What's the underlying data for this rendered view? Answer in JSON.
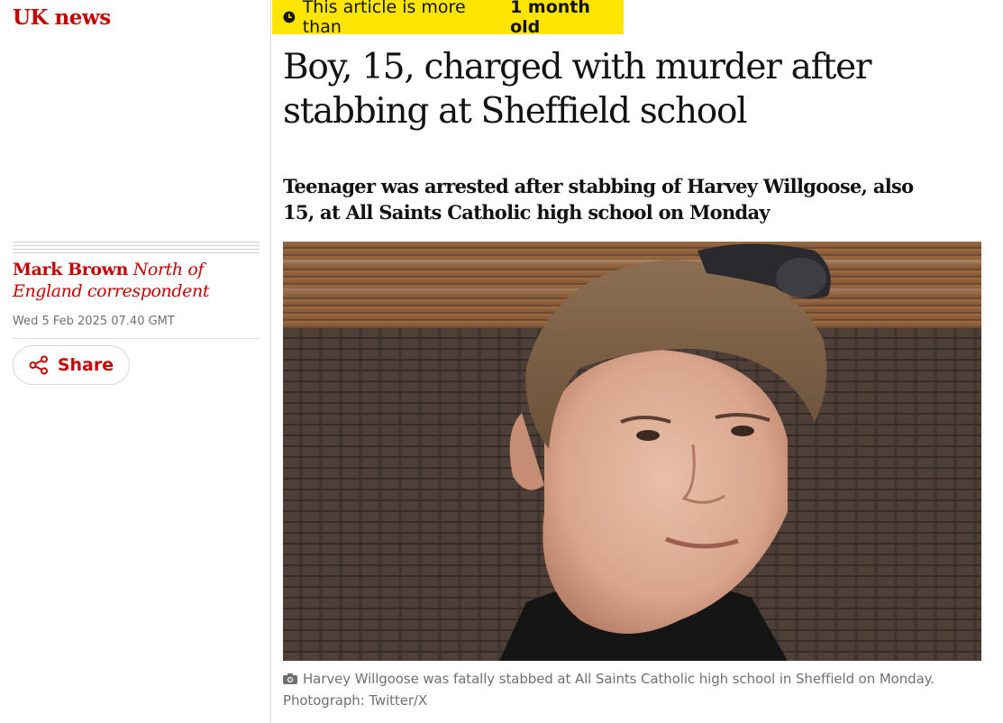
{
  "section": {
    "label": "UK news"
  },
  "byline": {
    "author": "Mark Brown",
    "role": "North of England correspondent",
    "date": "Wed 5 Feb 2025 07.40 GMT"
  },
  "share": {
    "label": "Share",
    "icon": "share-icon"
  },
  "age_notice": {
    "prefix": "This article is more than",
    "emphasis": "1 month old",
    "icon": "clock-icon"
  },
  "article": {
    "headline": "Boy, 15, charged with murder after stabbing at Sheffield school",
    "standfirst": "Teenager was arrested after stabbing of Harvey Willgoose, also 15, at All Saints Catholic high school on Monday"
  },
  "image": {
    "caption": "Harvey Willgoose was fatally stabbed at All Saints Catholic high school in Sheffield on Monday.",
    "credit": "Photograph: Twitter/X",
    "icon": "camera-icon"
  },
  "colors": {
    "brand_red": "#c70000",
    "badge_yellow": "#ffe500",
    "meta_grey": "#707070"
  }
}
